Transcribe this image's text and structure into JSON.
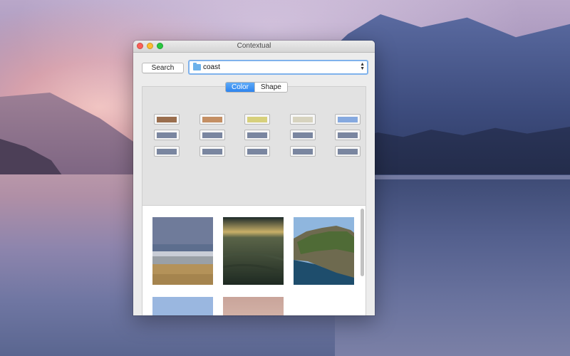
{
  "window": {
    "title": "Contextual"
  },
  "toolbar": {
    "search_label": "Search",
    "folder_value": "coast",
    "folder_icon": "folder-icon"
  },
  "tabs": {
    "items": [
      {
        "label": "Color",
        "active": true
      },
      {
        "label": "Shape",
        "active": false
      }
    ]
  },
  "colors": {
    "row1": [
      "#9a6e4e",
      "#c48f64",
      "#d7d07c",
      "#d7d3bf",
      "#86a9df"
    ],
    "row2": [
      "#7a86a0",
      "#7a86a0",
      "#7a86a0",
      "#7a86a0",
      "#7a86a0"
    ],
    "row3": [
      "#7a86a0",
      "#7a86a0",
      "#7a86a0",
      "#7a86a0",
      "#7a86a0"
    ]
  },
  "results": {
    "count_visible": 5
  }
}
